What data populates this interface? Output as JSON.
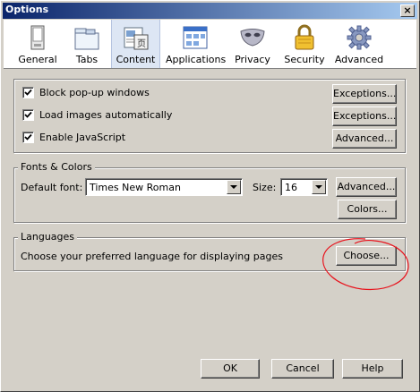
{
  "window": {
    "title": "Options",
    "close_label": "×"
  },
  "toolbar": {
    "tabs": [
      {
        "label": "General",
        "icon": "general-icon"
      },
      {
        "label": "Tabs",
        "icon": "tabs-icon"
      },
      {
        "label": "Content",
        "icon": "content-icon",
        "selected": true
      },
      {
        "label": "Applications",
        "icon": "applications-icon"
      },
      {
        "label": "Privacy",
        "icon": "privacy-mask-icon"
      },
      {
        "label": "Security",
        "icon": "lock-icon"
      },
      {
        "label": "Advanced",
        "icon": "gear-icon"
      }
    ]
  },
  "content": {
    "checks": [
      {
        "label": "Block pop-up windows",
        "checked": true,
        "button": "Exceptions..."
      },
      {
        "label": "Load images automatically",
        "checked": true,
        "button": "Exceptions..."
      },
      {
        "label": "Enable JavaScript",
        "checked": true,
        "button": "Advanced..."
      }
    ],
    "fonts": {
      "group_title": "Fonts & Colors",
      "default_font_label": "Default font:",
      "default_font_value": "Times New Roman",
      "size_label": "Size:",
      "size_value": "16",
      "advanced_button": "Advanced...",
      "colors_button": "Colors..."
    },
    "languages": {
      "group_title": "Languages",
      "description": "Choose your preferred language for displaying pages",
      "choose_button": "Choose..."
    }
  },
  "footer": {
    "ok": "OK",
    "cancel": "Cancel",
    "help": "Help"
  },
  "colors": {
    "title_start": "#0a246a",
    "title_end": "#a6caf0",
    "dialog_bg": "#d4d0c8",
    "annotation": "#e8101a"
  }
}
